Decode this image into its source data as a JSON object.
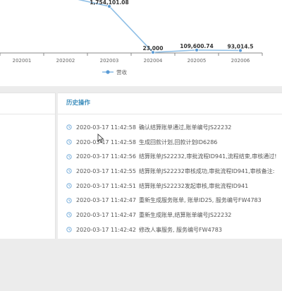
{
  "chart_data": {
    "type": "line",
    "categories": [
      "202001",
      "202002",
      "202003",
      "202004",
      "202005",
      "202006"
    ],
    "series": [
      {
        "name": "营收",
        "values": [
          null,
          null,
          1754101.08,
          23000,
          109600.74,
          93014.5
        ]
      }
    ],
    "data_labels": [
      "",
      "",
      "1,754,101.08",
      "23,000",
      "109,600.74",
      "93,014.5"
    ],
    "legend_position": "bottom",
    "colors": {
      "line": "#8fbfe6",
      "point": "#5b9bd5"
    }
  },
  "history": {
    "title": "历史操作",
    "icon": "clock-icon",
    "items": [
      {
        "time": "2020-03-17 11:42:58",
        "text": "确认结算账单通过,账单编号JS22232"
      },
      {
        "time": "2020-03-17 11:42:58",
        "text": "生成回款计划,回款计划ID6286"
      },
      {
        "time": "2020-03-17 11:42:56",
        "text": "结算账单JS22232,审批流程ID941,流程结束,审核通过!"
      },
      {
        "time": "2020-03-17 11:42:55",
        "text": "结算账单JS22232审核成功,审批流程ID941,审核备注:"
      },
      {
        "time": "2020-03-17 11:42:51",
        "text": "结算账单JS22232发起审核,审批流程ID941"
      },
      {
        "time": "2020-03-17 11:42:47",
        "text": "重新生成服务账单, 账单ID25, 服务编号FW4783"
      },
      {
        "time": "2020-03-17 11:42:47",
        "text": "重新生成账单,结算账单编号JS22232"
      },
      {
        "time": "2020-03-17 11:42:42",
        "text": "修改人事服务, 服务编号FW4783"
      }
    ]
  },
  "colors": {
    "accent": "#3c8dbc",
    "clock": "#6aa6d8"
  }
}
